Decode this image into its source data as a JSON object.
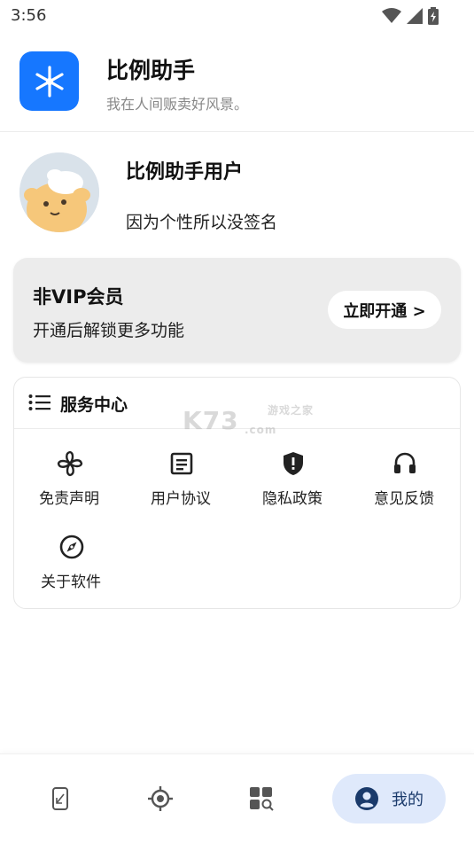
{
  "status_bar": {
    "time": "3:56"
  },
  "app": {
    "name": "比例助手",
    "slogan": "我在人间贩卖好风景。"
  },
  "profile": {
    "name": "比例助手用户",
    "bio": "因为个性所以没签名"
  },
  "vip": {
    "title": "非VIP会员",
    "desc": "开通后解锁更多功能",
    "button": "立即开通 >"
  },
  "services": {
    "title": "服务中心",
    "items": [
      {
        "label": "免责声明",
        "icon": "fan-icon"
      },
      {
        "label": "用户协议",
        "icon": "document-icon"
      },
      {
        "label": "隐私政策",
        "icon": "shield-icon"
      },
      {
        "label": "意见反馈",
        "icon": "headset-icon"
      },
      {
        "label": "关于软件",
        "icon": "compass-icon"
      }
    ]
  },
  "watermark": {
    "brand": "K73",
    "site": "游戏之家",
    "domain": ".com"
  },
  "bottom_nav": {
    "items": [
      {
        "icon": "phone-ruler-icon"
      },
      {
        "icon": "target-icon"
      },
      {
        "icon": "apps-search-icon"
      },
      {
        "icon": "user-icon",
        "label": "我的",
        "active": true
      }
    ]
  },
  "colors": {
    "brand": "#1677ff",
    "nav_active_bg": "#dfe9fb",
    "vip_card_bg": "#ececec"
  }
}
